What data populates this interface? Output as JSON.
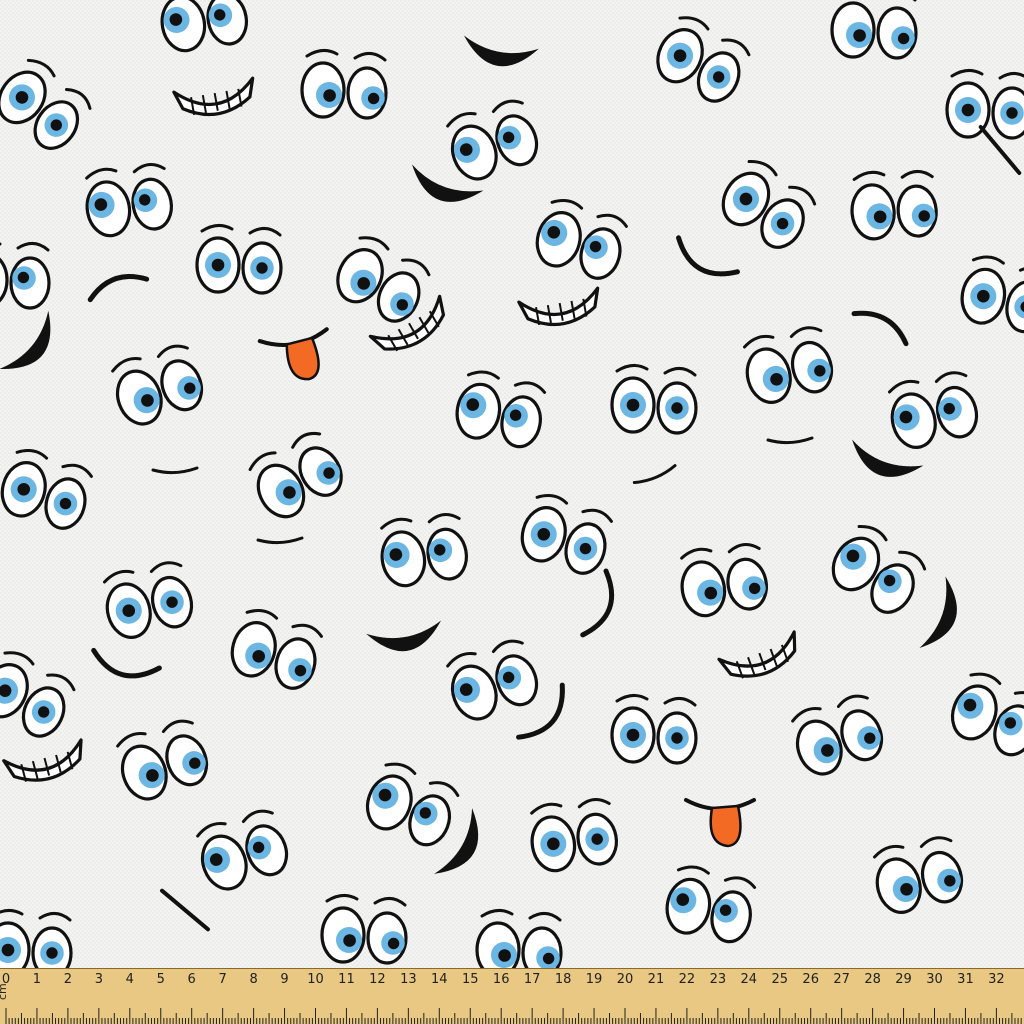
{
  "ruler": {
    "unit": "cm",
    "labels": [
      "0",
      "1",
      "2",
      "3",
      "4",
      "5",
      "6",
      "7",
      "8",
      "9",
      "10",
      "11",
      "12",
      "13",
      "14",
      "15",
      "16",
      "17",
      "18",
      "19",
      "20",
      "21",
      "22",
      "23",
      "24",
      "25",
      "26",
      "27",
      "28",
      "29",
      "30",
      "31",
      "32",
      "3"
    ]
  },
  "colors": {
    "fabric_background": "#f1f1f0",
    "outline": "#111111",
    "iris": "#6bb6e3",
    "tongue": "#f26a24",
    "ruler_wood": "#e8c882"
  },
  "motifs": {
    "eye_pairs": 46,
    "mouths": 24,
    "tongues": 2
  }
}
